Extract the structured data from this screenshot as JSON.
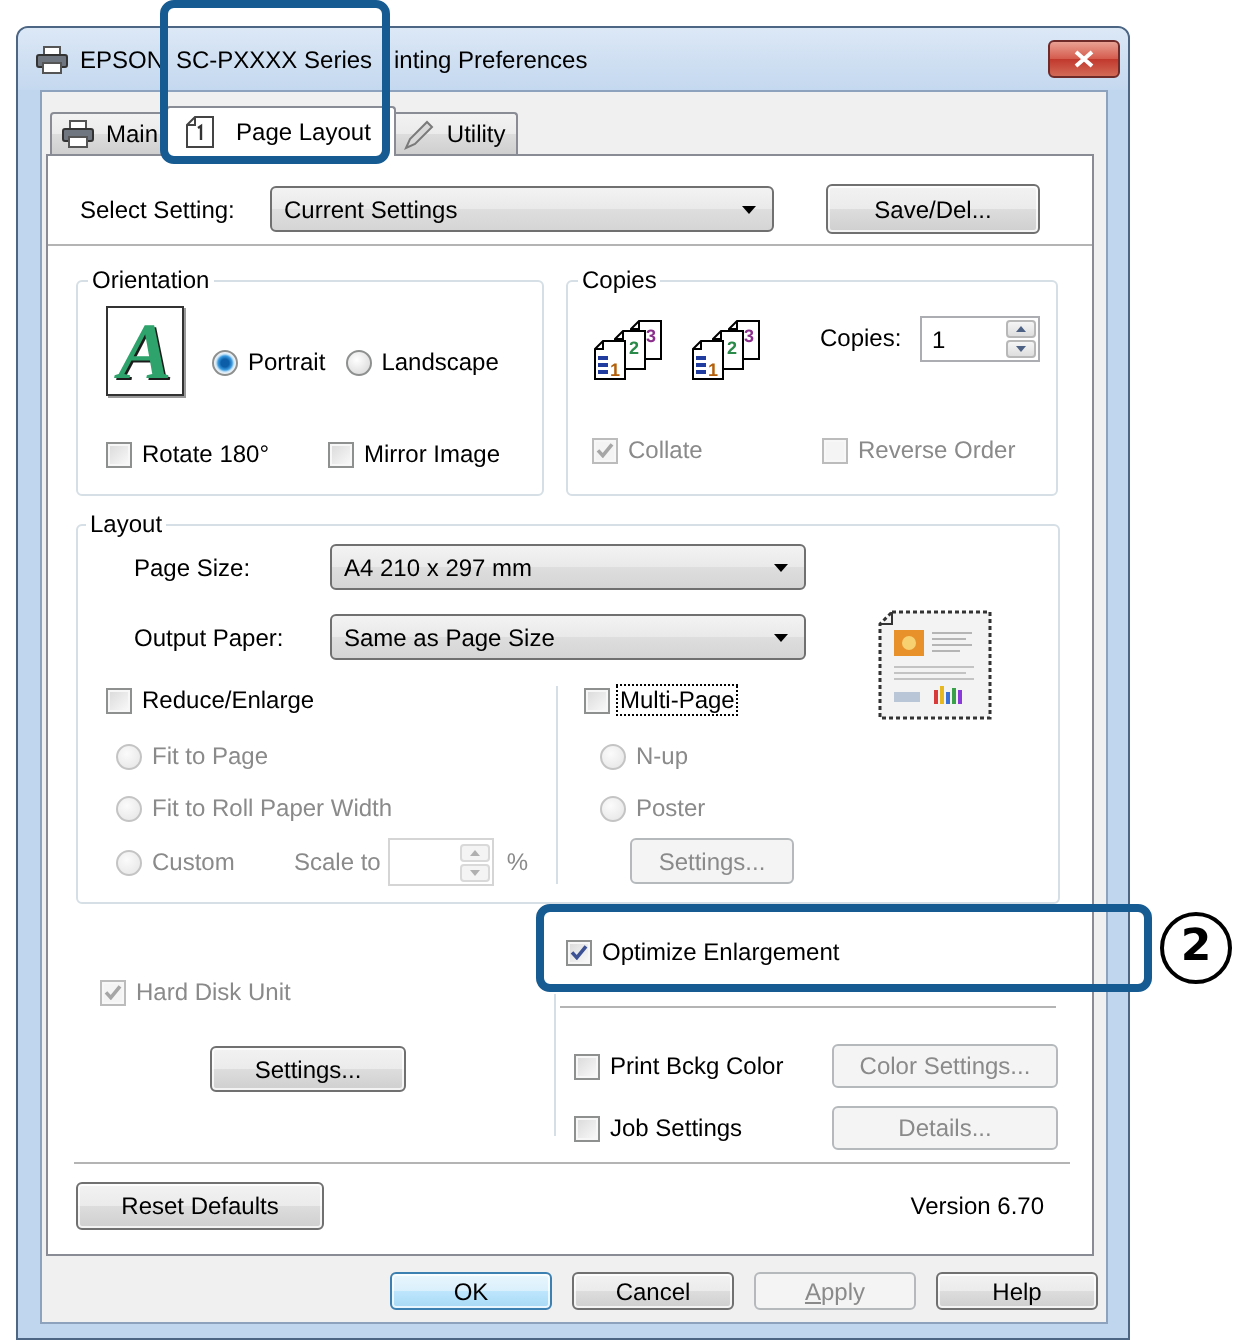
{
  "window": {
    "title_parts": [
      "EPSON",
      "SC-PXXXX Series",
      "inting Preferences"
    ]
  },
  "tabs": [
    {
      "label": "Main",
      "selected": false
    },
    {
      "label": "Page Layout",
      "selected": true
    },
    {
      "label": "Utility",
      "selected": false
    }
  ],
  "select_setting": {
    "label": "Select Setting:",
    "value": "Current Settings"
  },
  "save_delete_button": {
    "label": "Save/Del...",
    "disabled": false
  },
  "orientation": {
    "title": "Orientation",
    "preview_letter": "A",
    "options": [
      {
        "label": "Portrait",
        "selected": true,
        "disabled": false
      },
      {
        "label": "Landscape",
        "selected": false,
        "disabled": false
      }
    ],
    "checkboxes": [
      {
        "label": "Rotate 180°",
        "checked": false,
        "disabled": false
      },
      {
        "label": "Mirror Image",
        "checked": false,
        "disabled": false
      }
    ]
  },
  "copies": {
    "title": "Copies",
    "collate_icons": [
      {
        "pages": [
          "1",
          "2",
          "3"
        ]
      },
      {
        "pages": [
          "1",
          "2",
          "3"
        ]
      }
    ],
    "label": "Copies:",
    "value": "1",
    "checkboxes": [
      {
        "label": "Collate",
        "checked": true,
        "disabled": true
      },
      {
        "label": "Reverse Order",
        "checked": false,
        "disabled": true
      }
    ]
  },
  "layout": {
    "title": "Layout",
    "page_size": {
      "label": "Page Size:",
      "value": "A4 210 x 297 mm"
    },
    "output_paper": {
      "label": "Output Paper:",
      "value": "Same as Page Size"
    },
    "reduce_enlarge": {
      "label": "Reduce/Enlarge",
      "checked": false,
      "disabled": false
    },
    "scale_options": [
      {
        "label": "Fit to Page",
        "selected": false,
        "disabled": true
      },
      {
        "label": "Fit to Roll Paper Width",
        "selected": false,
        "disabled": true
      },
      {
        "label": "Custom",
        "selected": false,
        "disabled": true
      }
    ],
    "scale_to": {
      "label": "Scale to",
      "unit": "%",
      "disabled": true
    },
    "multi_page": {
      "label": "Multi-Page",
      "checked": false,
      "disabled": false,
      "focused": true
    },
    "multi_page_options": [
      {
        "label": "N-up",
        "selected": false,
        "disabled": true
      },
      {
        "label": "Poster",
        "selected": false,
        "disabled": true
      }
    ],
    "multi_page_settings": {
      "label": "Settings...",
      "disabled": true
    }
  },
  "optimize_enlargement": {
    "label": "Optimize Enlargement",
    "checked": true,
    "disabled": false
  },
  "hard_disk_unit": {
    "label": "Hard Disk Unit",
    "checked": true,
    "disabled": true
  },
  "hard_disk_settings": {
    "label": "Settings...",
    "disabled": false
  },
  "extras": [
    {
      "label": "Print Bckg Color",
      "checked": false,
      "disabled": false,
      "button": {
        "label": "Color Settings...",
        "disabled": true
      }
    },
    {
      "label": "Job Settings",
      "checked": false,
      "disabled": false,
      "button": {
        "label": "Details...",
        "disabled": true
      }
    }
  ],
  "reset_defaults": {
    "label": "Reset Defaults",
    "disabled": false
  },
  "version": "Version 6.70",
  "dialog_buttons": [
    {
      "label": "OK",
      "default": true,
      "disabled": false,
      "access_key": false
    },
    {
      "label": "Cancel",
      "default": false,
      "disabled": false,
      "access_key": false
    },
    {
      "label": "Apply",
      "default": false,
      "disabled": true,
      "access_key": true
    },
    {
      "label": "Help",
      "default": false,
      "disabled": false,
      "access_key": false
    }
  ],
  "step_marker": "2"
}
